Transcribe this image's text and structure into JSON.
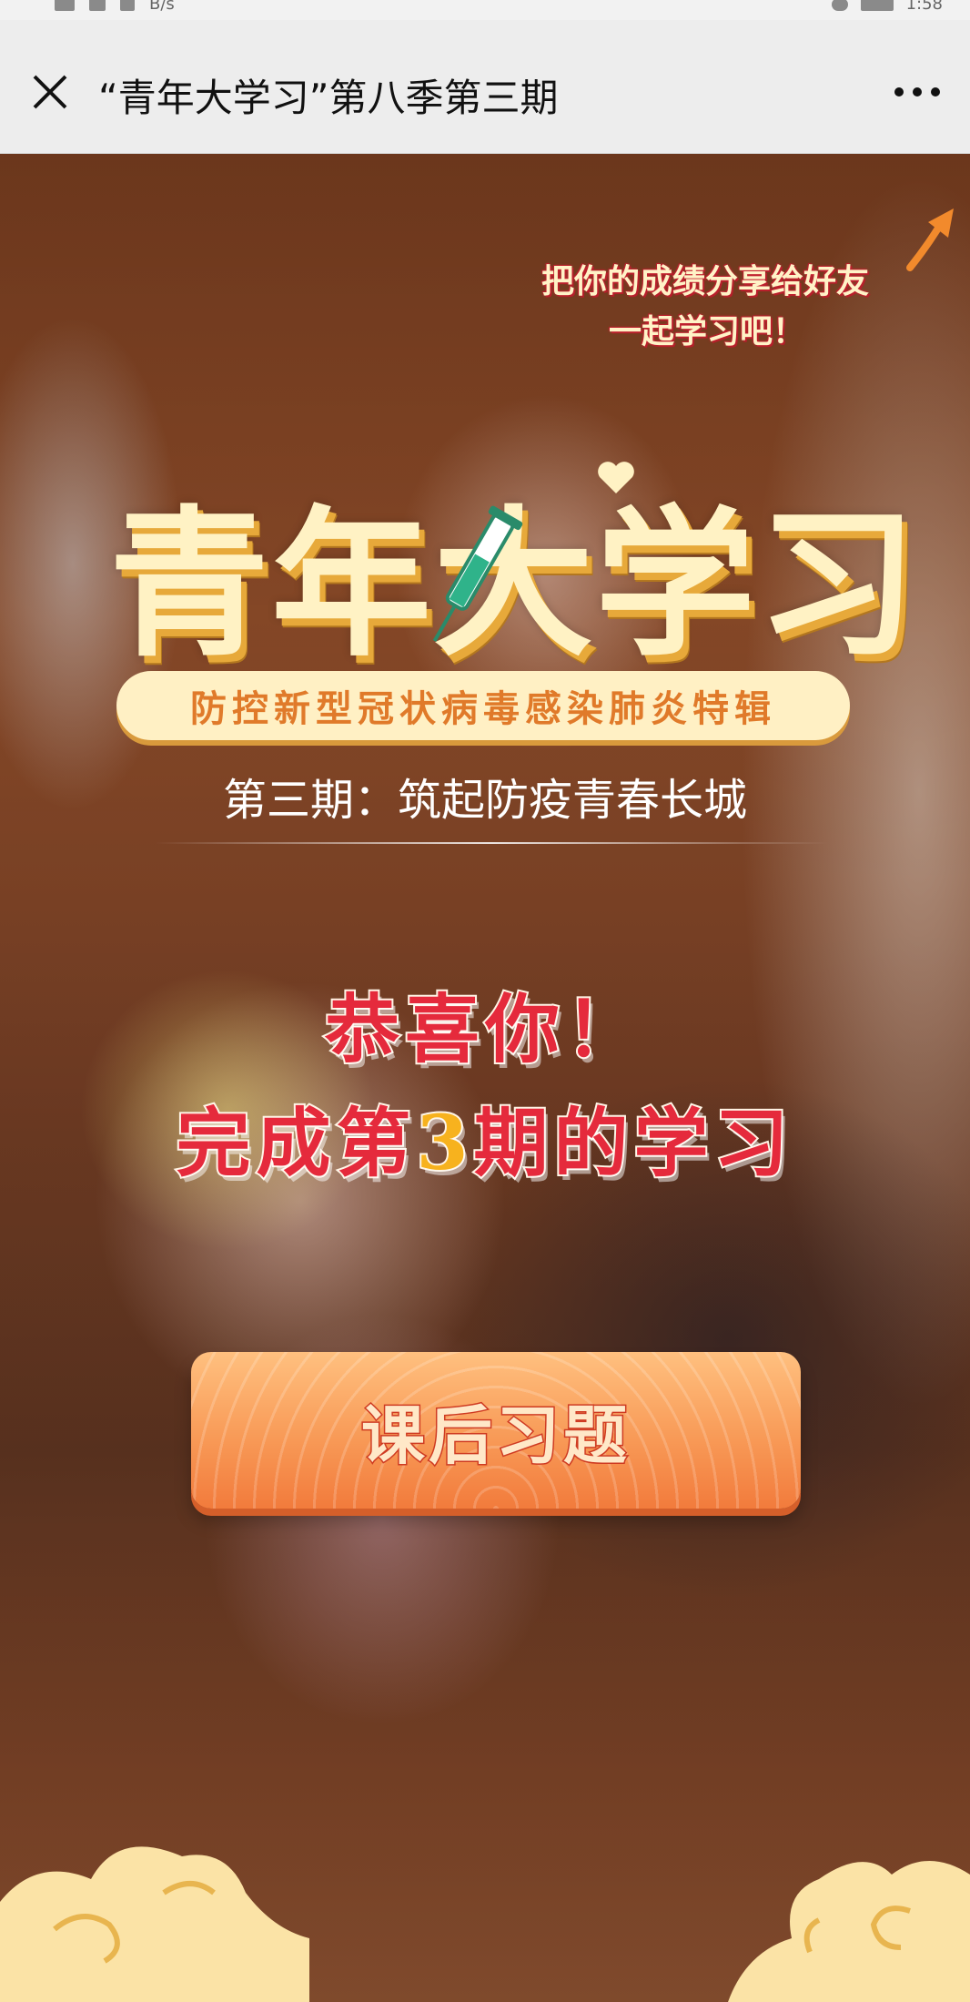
{
  "status_bar": {
    "network_speed": "B/s",
    "time": "1:58"
  },
  "nav": {
    "title": "“青年大学习”第八季第三期"
  },
  "share_tip": {
    "line1": "把你的成绩分享给好友",
    "line2": "一起学习吧！"
  },
  "logo": {
    "title": "青年大学习",
    "subtitle": "防控新型冠状病毒感染肺炎特辑"
  },
  "issue": {
    "title": "第三期：筑起防疫青春长城"
  },
  "congrats": {
    "line1": "恭喜你！",
    "line2_prefix": "完成第",
    "line2_number": "3",
    "line2_suffix": "期的学习"
  },
  "button": {
    "label": "课后习题"
  },
  "colors": {
    "accent_red": "#e52a3c",
    "button_orange": "#f89a57",
    "title_cream": "#fff2c4"
  }
}
